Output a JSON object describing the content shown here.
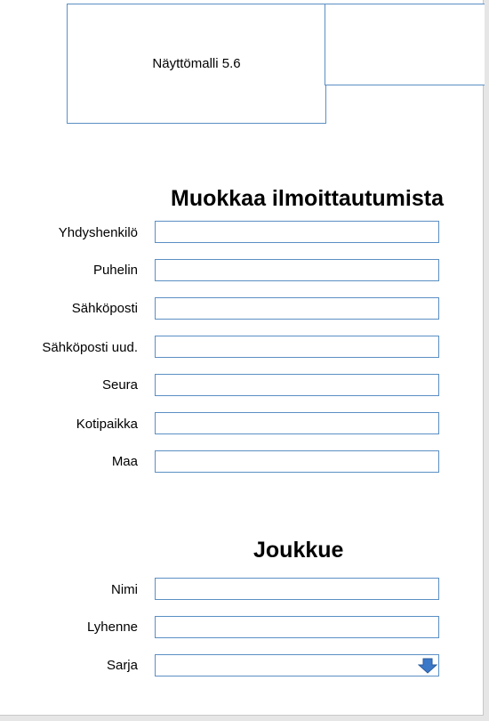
{
  "header": {
    "model_label": "Näyttömalli 5.6"
  },
  "registration": {
    "title": "Muokkaa ilmoittautumista",
    "fields": {
      "contact": {
        "label": "Yhdyshenkilö",
        "value": ""
      },
      "phone": {
        "label": "Puhelin",
        "value": ""
      },
      "email": {
        "label": "Sähköposti",
        "value": ""
      },
      "email_confirm": {
        "label": "Sähköposti uud.",
        "value": ""
      },
      "club": {
        "label": "Seura",
        "value": ""
      },
      "hometown": {
        "label": "Kotipaikka",
        "value": ""
      },
      "country": {
        "label": "Maa",
        "value": ""
      }
    }
  },
  "team": {
    "title": "Joukkue",
    "fields": {
      "name": {
        "label": "Nimi",
        "value": ""
      },
      "abbreviation": {
        "label": "Lyhenne",
        "value": ""
      },
      "series": {
        "label": "Sarja",
        "value": ""
      }
    }
  },
  "colors": {
    "border": "#5b8fc4",
    "arrow": "#3c78c8"
  }
}
